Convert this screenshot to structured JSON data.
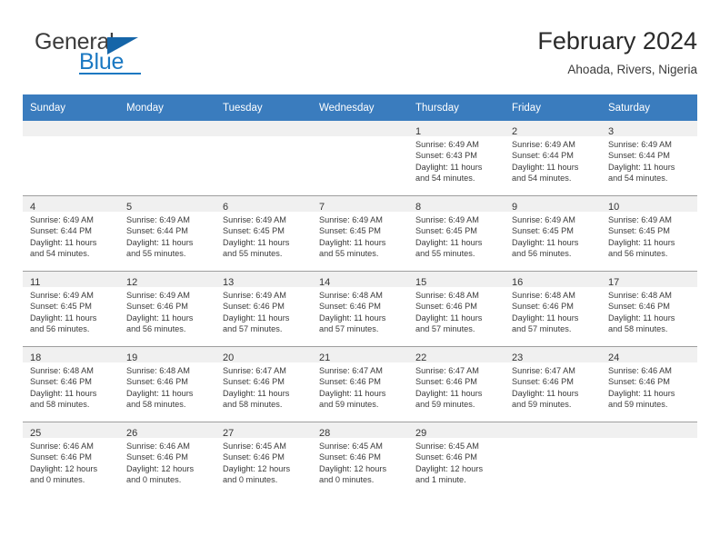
{
  "brand": {
    "name_top": "General",
    "name_bottom": "Blue",
    "accent_color": "#1a78c2"
  },
  "header": {
    "title": "February 2024",
    "location": "Ahoada, Rivers, Nigeria"
  },
  "calendar": {
    "header_bg": "#3a7cbe",
    "weekdays": [
      "Sunday",
      "Monday",
      "Tuesday",
      "Wednesday",
      "Thursday",
      "Friday",
      "Saturday"
    ],
    "weeks": [
      [
        {
          "day": "",
          "lines": []
        },
        {
          "day": "",
          "lines": []
        },
        {
          "day": "",
          "lines": []
        },
        {
          "day": "",
          "lines": []
        },
        {
          "day": "1",
          "lines": [
            "Sunrise: 6:49 AM",
            "Sunset: 6:43 PM",
            "Daylight: 11 hours",
            "and 54 minutes."
          ]
        },
        {
          "day": "2",
          "lines": [
            "Sunrise: 6:49 AM",
            "Sunset: 6:44 PM",
            "Daylight: 11 hours",
            "and 54 minutes."
          ]
        },
        {
          "day": "3",
          "lines": [
            "Sunrise: 6:49 AM",
            "Sunset: 6:44 PM",
            "Daylight: 11 hours",
            "and 54 minutes."
          ]
        }
      ],
      [
        {
          "day": "4",
          "lines": [
            "Sunrise: 6:49 AM",
            "Sunset: 6:44 PM",
            "Daylight: 11 hours",
            "and 54 minutes."
          ]
        },
        {
          "day": "5",
          "lines": [
            "Sunrise: 6:49 AM",
            "Sunset: 6:44 PM",
            "Daylight: 11 hours",
            "and 55 minutes."
          ]
        },
        {
          "day": "6",
          "lines": [
            "Sunrise: 6:49 AM",
            "Sunset: 6:45 PM",
            "Daylight: 11 hours",
            "and 55 minutes."
          ]
        },
        {
          "day": "7",
          "lines": [
            "Sunrise: 6:49 AM",
            "Sunset: 6:45 PM",
            "Daylight: 11 hours",
            "and 55 minutes."
          ]
        },
        {
          "day": "8",
          "lines": [
            "Sunrise: 6:49 AM",
            "Sunset: 6:45 PM",
            "Daylight: 11 hours",
            "and 55 minutes."
          ]
        },
        {
          "day": "9",
          "lines": [
            "Sunrise: 6:49 AM",
            "Sunset: 6:45 PM",
            "Daylight: 11 hours",
            "and 56 minutes."
          ]
        },
        {
          "day": "10",
          "lines": [
            "Sunrise: 6:49 AM",
            "Sunset: 6:45 PM",
            "Daylight: 11 hours",
            "and 56 minutes."
          ]
        }
      ],
      [
        {
          "day": "11",
          "lines": [
            "Sunrise: 6:49 AM",
            "Sunset: 6:45 PM",
            "Daylight: 11 hours",
            "and 56 minutes."
          ]
        },
        {
          "day": "12",
          "lines": [
            "Sunrise: 6:49 AM",
            "Sunset: 6:46 PM",
            "Daylight: 11 hours",
            "and 56 minutes."
          ]
        },
        {
          "day": "13",
          "lines": [
            "Sunrise: 6:49 AM",
            "Sunset: 6:46 PM",
            "Daylight: 11 hours",
            "and 57 minutes."
          ]
        },
        {
          "day": "14",
          "lines": [
            "Sunrise: 6:48 AM",
            "Sunset: 6:46 PM",
            "Daylight: 11 hours",
            "and 57 minutes."
          ]
        },
        {
          "day": "15",
          "lines": [
            "Sunrise: 6:48 AM",
            "Sunset: 6:46 PM",
            "Daylight: 11 hours",
            "and 57 minutes."
          ]
        },
        {
          "day": "16",
          "lines": [
            "Sunrise: 6:48 AM",
            "Sunset: 6:46 PM",
            "Daylight: 11 hours",
            "and 57 minutes."
          ]
        },
        {
          "day": "17",
          "lines": [
            "Sunrise: 6:48 AM",
            "Sunset: 6:46 PM",
            "Daylight: 11 hours",
            "and 58 minutes."
          ]
        }
      ],
      [
        {
          "day": "18",
          "lines": [
            "Sunrise: 6:48 AM",
            "Sunset: 6:46 PM",
            "Daylight: 11 hours",
            "and 58 minutes."
          ]
        },
        {
          "day": "19",
          "lines": [
            "Sunrise: 6:48 AM",
            "Sunset: 6:46 PM",
            "Daylight: 11 hours",
            "and 58 minutes."
          ]
        },
        {
          "day": "20",
          "lines": [
            "Sunrise: 6:47 AM",
            "Sunset: 6:46 PM",
            "Daylight: 11 hours",
            "and 58 minutes."
          ]
        },
        {
          "day": "21",
          "lines": [
            "Sunrise: 6:47 AM",
            "Sunset: 6:46 PM",
            "Daylight: 11 hours",
            "and 59 minutes."
          ]
        },
        {
          "day": "22",
          "lines": [
            "Sunrise: 6:47 AM",
            "Sunset: 6:46 PM",
            "Daylight: 11 hours",
            "and 59 minutes."
          ]
        },
        {
          "day": "23",
          "lines": [
            "Sunrise: 6:47 AM",
            "Sunset: 6:46 PM",
            "Daylight: 11 hours",
            "and 59 minutes."
          ]
        },
        {
          "day": "24",
          "lines": [
            "Sunrise: 6:46 AM",
            "Sunset: 6:46 PM",
            "Daylight: 11 hours",
            "and 59 minutes."
          ]
        }
      ],
      [
        {
          "day": "25",
          "lines": [
            "Sunrise: 6:46 AM",
            "Sunset: 6:46 PM",
            "Daylight: 12 hours",
            "and 0 minutes."
          ]
        },
        {
          "day": "26",
          "lines": [
            "Sunrise: 6:46 AM",
            "Sunset: 6:46 PM",
            "Daylight: 12 hours",
            "and 0 minutes."
          ]
        },
        {
          "day": "27",
          "lines": [
            "Sunrise: 6:45 AM",
            "Sunset: 6:46 PM",
            "Daylight: 12 hours",
            "and 0 minutes."
          ]
        },
        {
          "day": "28",
          "lines": [
            "Sunrise: 6:45 AM",
            "Sunset: 6:46 PM",
            "Daylight: 12 hours",
            "and 0 minutes."
          ]
        },
        {
          "day": "29",
          "lines": [
            "Sunrise: 6:45 AM",
            "Sunset: 6:46 PM",
            "Daylight: 12 hours",
            "and 1 minute."
          ]
        },
        {
          "day": "",
          "lines": []
        },
        {
          "day": "",
          "lines": []
        }
      ]
    ]
  }
}
